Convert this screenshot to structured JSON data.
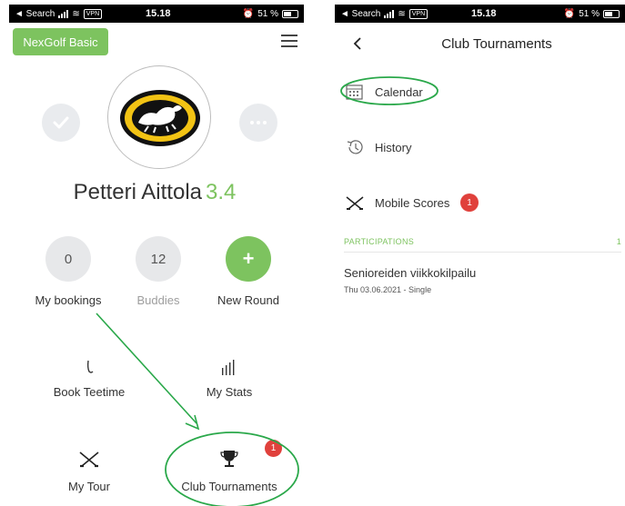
{
  "status_bar_left": {
    "back_app": "◄ Search",
    "vpn": "VPN",
    "time": "15.18",
    "battery": "51 %"
  },
  "status_bar_right": {
    "back_app": "◄ Search",
    "vpn": "VPN",
    "time": "15.18",
    "battery": "51 %"
  },
  "home": {
    "plan_badge": "NexGolf Basic",
    "user_name": "Petteri Aittola",
    "handicap": "3.4",
    "stats": [
      {
        "value": "0",
        "label": "My bookings"
      },
      {
        "value": "12",
        "label": "Buddies"
      },
      {
        "value": "+",
        "label": "New Round"
      }
    ],
    "tiles": [
      {
        "label": "Book Teetime",
        "icon": "tee-icon"
      },
      {
        "label": "My Stats",
        "icon": "stats-bars-icon"
      },
      {
        "label": "My Tour",
        "icon": "crossed-clubs-icon"
      },
      {
        "label": "Club Tournaments",
        "icon": "trophy-icon",
        "badge": "1"
      }
    ]
  },
  "tournaments": {
    "title": "Club Tournaments",
    "menu": [
      {
        "label": "Calendar",
        "icon": "calendar-icon"
      },
      {
        "label": "History",
        "icon": "history-icon"
      },
      {
        "label": "Mobile Scores",
        "icon": "crossed-clubs-icon",
        "badge": "1"
      }
    ],
    "section_title": "PARTICIPATIONS",
    "section_count": "1",
    "participations": [
      {
        "name": "Senioreiden viikkokilpailu",
        "meta": "Thu 03.06.2021 - Single"
      }
    ]
  },
  "colors": {
    "accent_green": "#7dc35f",
    "badge_red": "#e0413c",
    "annotation_green": "#1e9e3a"
  }
}
